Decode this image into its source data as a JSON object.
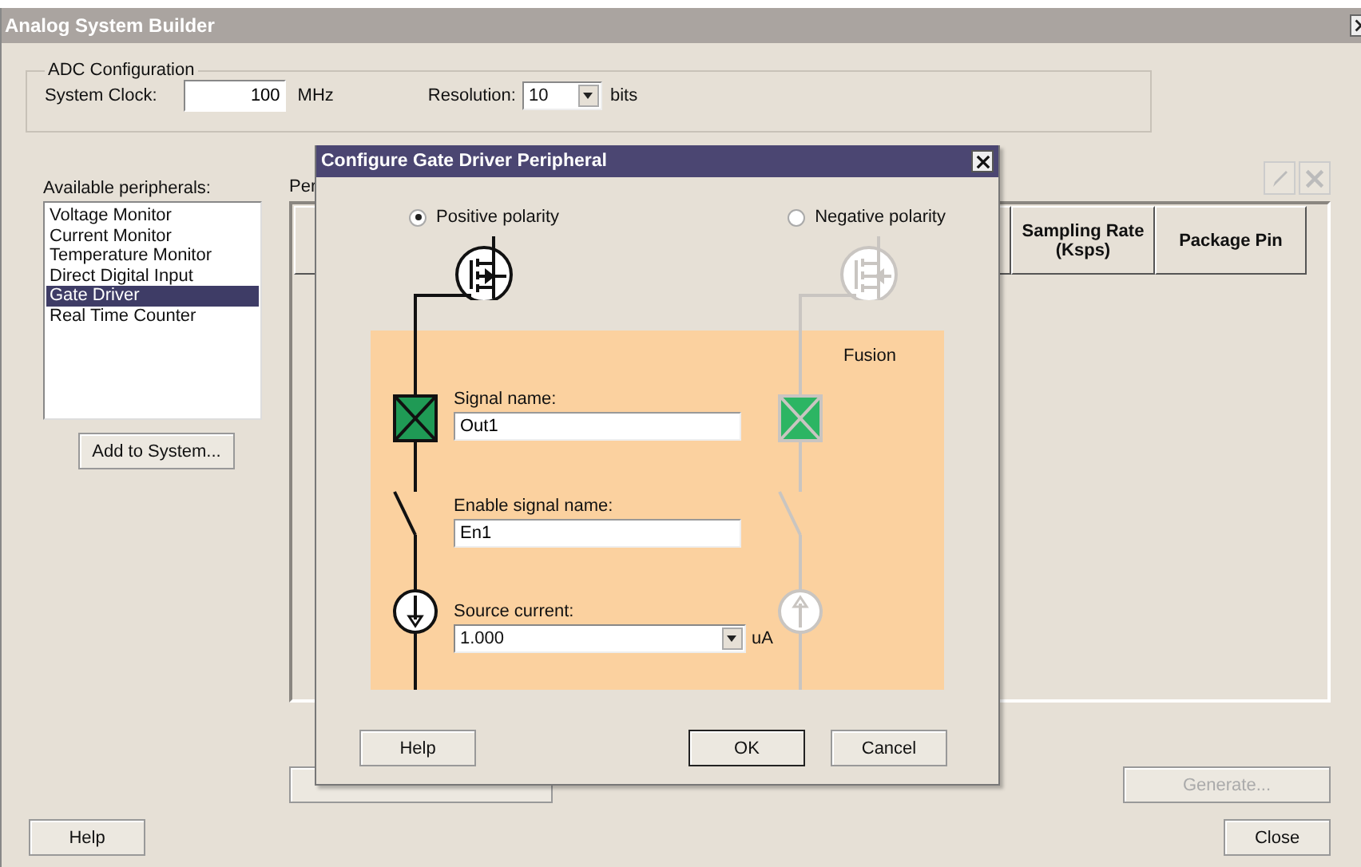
{
  "window": {
    "title": "Analog System Builder"
  },
  "adc_configuration": {
    "title": "ADC Configuration",
    "system_clock": {
      "label": "System Clock:",
      "value": "100",
      "unit": "MHz"
    },
    "resolution": {
      "label": "Resolution:",
      "value": "10",
      "unit": "bits"
    }
  },
  "peripherals": {
    "label": "Available peripherals:",
    "items": [
      {
        "label": "Voltage Monitor",
        "selected": false
      },
      {
        "label": "Current Monitor",
        "selected": false
      },
      {
        "label": "Temperature Monitor",
        "selected": false
      },
      {
        "label": "Direct Digital Input",
        "selected": false
      },
      {
        "label": "Gate Driver",
        "selected": true
      },
      {
        "label": "Real Time Counter",
        "selected": false
      }
    ],
    "add_button": "Add to System..."
  },
  "system_table": {
    "label": "Per",
    "toolbar": [
      {
        "kind": "edit",
        "disabled": true
      },
      {
        "kind": "delete",
        "disabled": true
      }
    ],
    "columns": [
      "Sampling Rate (Ksps)",
      "Package Pin"
    ]
  },
  "generate_button": {
    "label": "Generate...",
    "disabled": true
  },
  "help_button": "Help",
  "close_button": "Close",
  "dialog": {
    "title": "Configure Gate Driver Peripheral",
    "polarities": [
      {
        "label": "Positive polarity",
        "kind": "positive",
        "selected": true
      },
      {
        "label": "Negative polarity",
        "kind": "negative",
        "selected": false
      }
    ],
    "device_label": "Fusion",
    "signal_name": {
      "label": "Signal name:",
      "value": "Out1"
    },
    "enable_signal_name": {
      "label": "Enable signal name:",
      "value": "En1"
    },
    "source_current": {
      "label": "Source current:",
      "value": "1.000",
      "unit": "uA"
    },
    "buttons": [
      "Help",
      "OK",
      "Cancel"
    ]
  }
}
